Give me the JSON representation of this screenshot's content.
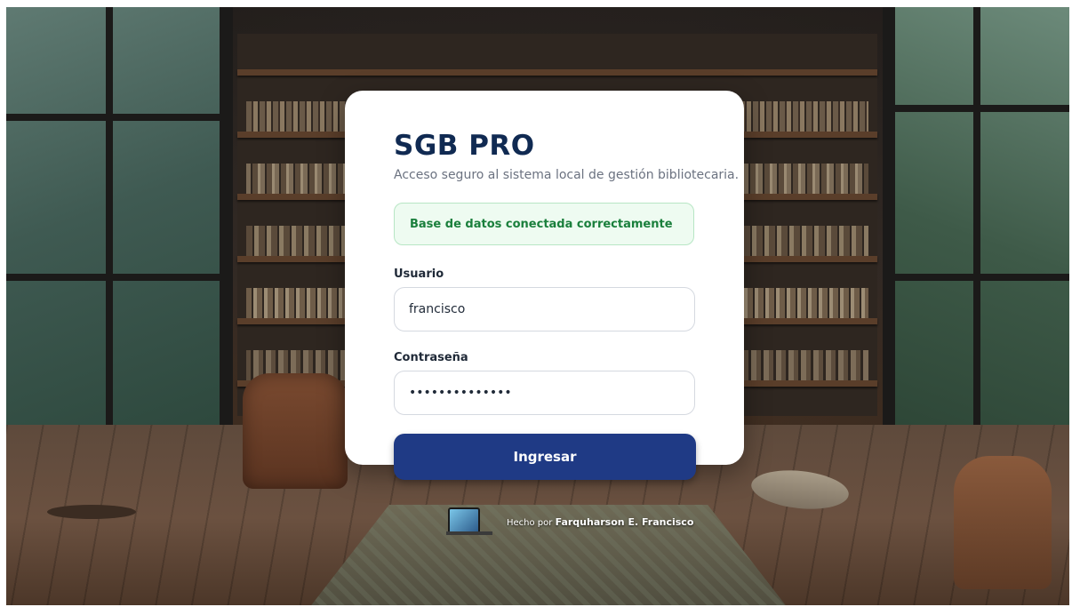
{
  "login": {
    "title": "SGB PRO",
    "subtitle": "Acceso seguro al sistema local de gestión bibliotecaria.",
    "status_message": "Base de datos conectada correctamente",
    "username_label": "Usuario",
    "username_value": "francisco",
    "password_label": "Contraseña",
    "password_value": "••••••••••••••",
    "submit_label": "Ingresar"
  },
  "footer": {
    "prefix": "Hecho por",
    "author": "Farquharson E. Francisco"
  },
  "colors": {
    "title": "#102a52",
    "button": "#1f3a85",
    "status_bg": "#eefbf1",
    "status_text": "#1a7f3c"
  }
}
